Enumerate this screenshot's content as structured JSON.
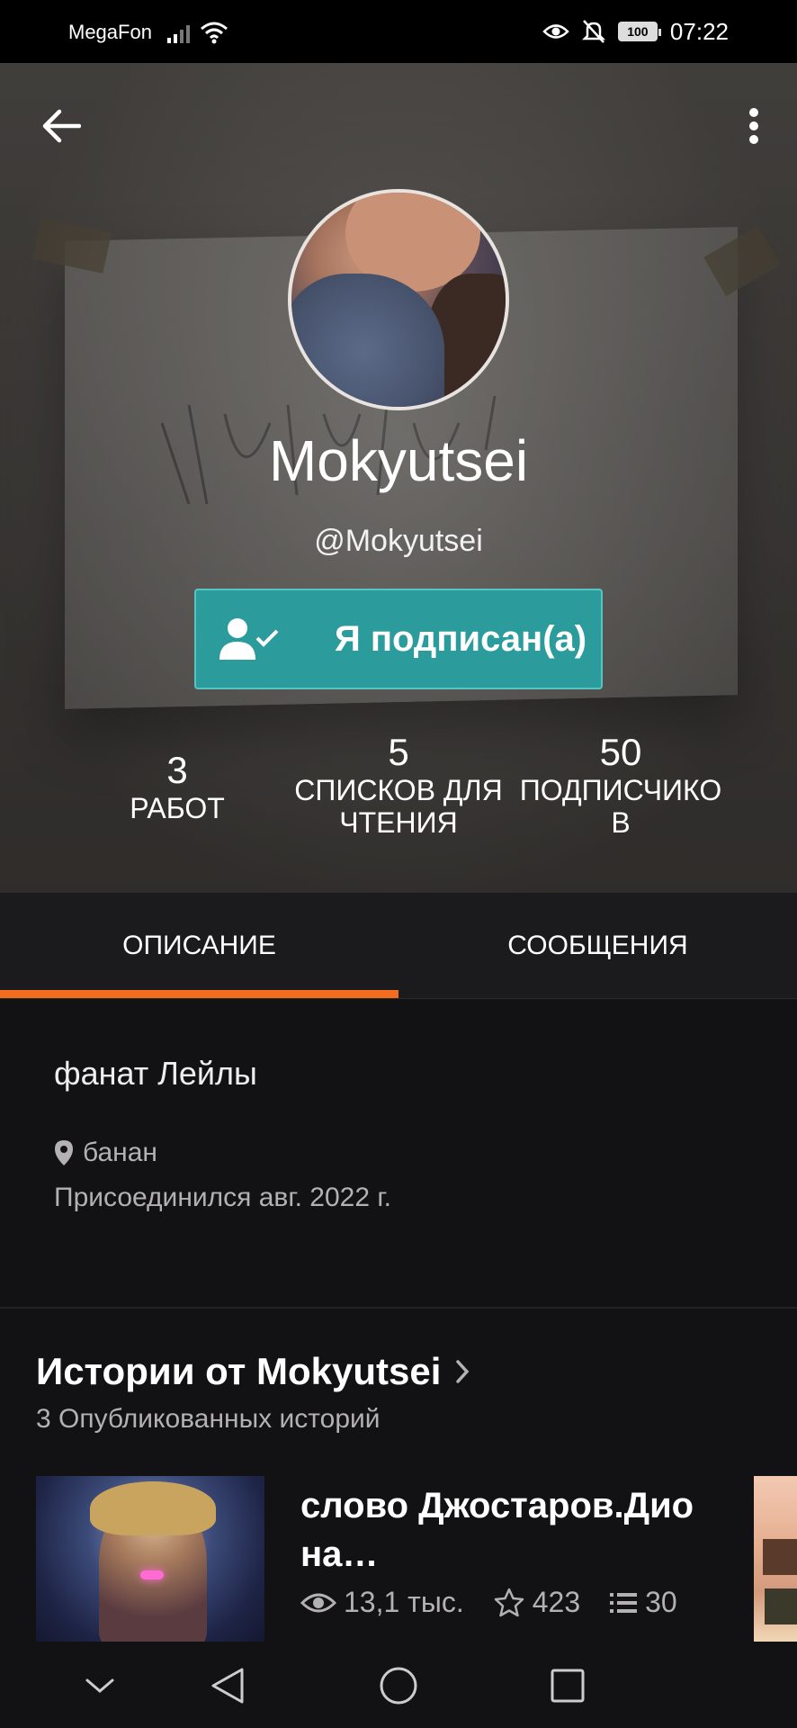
{
  "status_bar": {
    "carrier": "MegaFon",
    "battery": "100",
    "time": "07:22"
  },
  "profile": {
    "name": "Mokyutsei",
    "handle": "@Mokyutsei",
    "follow_label": "Я подписан(а)",
    "stats": [
      {
        "value": "3",
        "label": "РАБОТ"
      },
      {
        "value": "5",
        "label": "СПИСКОВ ДЛЯ ЧТЕНИЯ"
      },
      {
        "value": "50",
        "label": "ПОДПИСЧИКО В"
      }
    ]
  },
  "tabs": {
    "description": "ОПИСАНИЕ",
    "messages": "СООБЩЕНИЯ",
    "active": "description"
  },
  "about": {
    "bio": "фанат Лейлы",
    "location": "банан",
    "joined": "Присоединился авг. 2022 г."
  },
  "stories": {
    "title": "Истории от Mokyutsei",
    "subtitle": "3 Опубликованных историй",
    "items": [
      {
        "title": "слово Джостаров.Дио на…",
        "views": "13,1 тыс.",
        "votes": "423",
        "parts": "30"
      }
    ]
  },
  "colors": {
    "accent": "#f36d21",
    "follow": "#2b9c9b"
  }
}
